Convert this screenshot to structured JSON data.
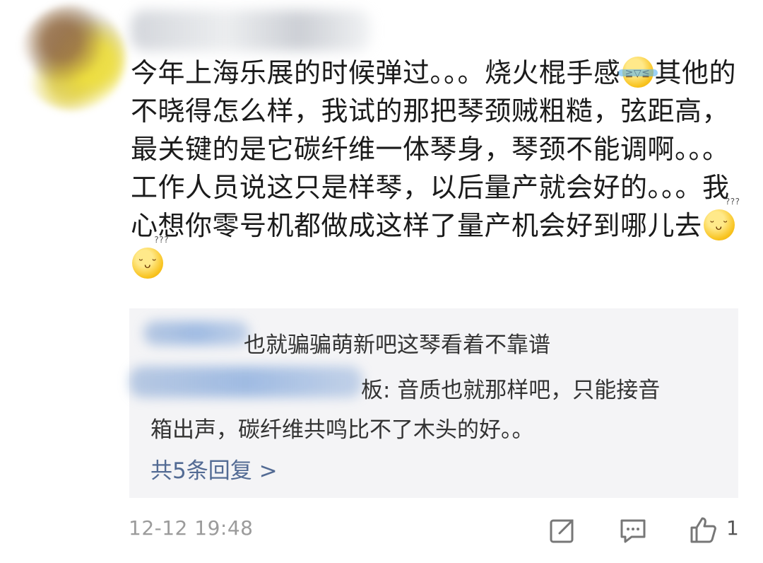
{
  "comment": {
    "text_1": "今年上海乐展的时候弹过。。。烧火棍手感",
    "text_2": "其他的不晓得怎么样，我试的那把琴颈贼粗糙，弦距高，最关键的是它碳纤维一体琴身，琴颈不能调啊。。。工作人员说这只是样琴，以后量产就会好的。。。我心想你零号机都做成这样了量产机会好到哪儿去",
    "emoji_1": "laughing-crying-emoji",
    "emoji_2": "dizzy-emoji",
    "timestamp": "12-12 19:48",
    "like_count": "1"
  },
  "replies": {
    "items": [
      {
        "text": "也就骗骗萌新吧这琴看着不靠谱"
      },
      {
        "text_1": "板: 音质也就那样吧，只能接音",
        "text_2": "箱出声，碳纤维共鸣比不了木头的好。。"
      }
    ],
    "more_label": "共5条回复 >"
  },
  "icons": {
    "share": "share-icon",
    "comment": "comment-icon",
    "like": "thumbs-up-icon"
  },
  "colors": {
    "link": "#536b94",
    "reply_bg": "#f4f4f6",
    "meta_text": "#9b9b9b"
  }
}
